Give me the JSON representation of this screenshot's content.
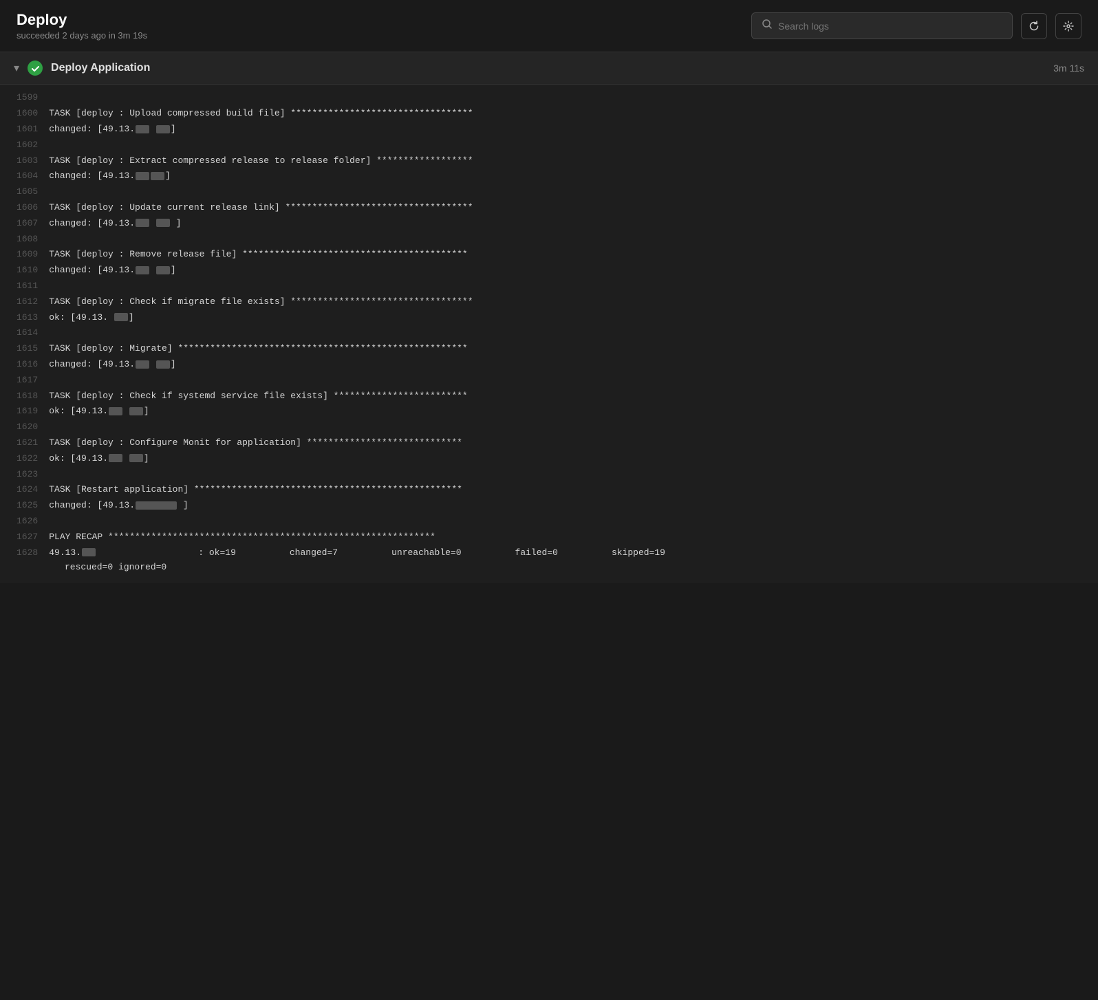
{
  "header": {
    "title": "Deploy",
    "subtitle": "succeeded 2 days ago in 3m 19s",
    "search_placeholder": "Search logs"
  },
  "section": {
    "title": "Deploy Application",
    "duration": "3m 11s",
    "chevron": "▾",
    "status": "✓"
  },
  "toolbar": {
    "refresh_label": "Refresh",
    "settings_label": "Settings"
  },
  "log_lines": [
    {
      "num": "1599",
      "content": ""
    },
    {
      "num": "1600",
      "content": "TASK [deploy : Upload compressed build file] **********************************"
    },
    {
      "num": "1601",
      "content": "changed: [49.13.REDACTED_SM REDACTED]"
    },
    {
      "num": "1602",
      "content": ""
    },
    {
      "num": "1603",
      "content": "TASK [deploy : Extract compressed release to release folder] ******************"
    },
    {
      "num": "1604",
      "content": "changed: [49.13.REDACTED_SM REDACTED_SM]"
    },
    {
      "num": "1605",
      "content": ""
    },
    {
      "num": "1606",
      "content": "TASK [deploy : Update current release link] ***********************************"
    },
    {
      "num": "1607",
      "content": "changed: [49.13.REDACTED_SM REDACTED_SM ]"
    },
    {
      "num": "1608",
      "content": ""
    },
    {
      "num": "1609",
      "content": "TASK [deploy : Remove release file] ******************************************"
    },
    {
      "num": "1610",
      "content": "changed: [49.13.REDACTED_SM REDACTED_SM]"
    },
    {
      "num": "1611",
      "content": ""
    },
    {
      "num": "1612",
      "content": "TASK [deploy : Check if migrate file exists] **********************************"
    },
    {
      "num": "1613",
      "content": "ok: [49.13. REDACTED_SM]"
    },
    {
      "num": "1614",
      "content": ""
    },
    {
      "num": "1615",
      "content": "TASK [deploy : Migrate] ******************************************************"
    },
    {
      "num": "1616",
      "content": "changed: [49.13.REDACTED_SM REDACTED_SM]"
    },
    {
      "num": "1617",
      "content": ""
    },
    {
      "num": "1618",
      "content": "TASK [deploy : Check if systemd service file exists] *************************"
    },
    {
      "num": "1619",
      "content": "ok: [49.13.REDACTED_SM REDACTED_SM]"
    },
    {
      "num": "1620",
      "content": ""
    },
    {
      "num": "1621",
      "content": "TASK [deploy : Configure Monit for application] *****************************"
    },
    {
      "num": "1622",
      "content": "ok: [49.13.REDACTED_SM REDACTED_SM]"
    },
    {
      "num": "1623",
      "content": ""
    },
    {
      "num": "1624",
      "content": "TASK [Restart application] **************************************************"
    },
    {
      "num": "1625",
      "content": "changed: [49.13.REDACTED_SM ]"
    },
    {
      "num": "1626",
      "content": ""
    },
    {
      "num": "1627",
      "content": "PLAY RECAP *************************************************************"
    },
    {
      "num": "1628",
      "content": "RECAP_LINE"
    }
  ],
  "recap": {
    "ip": "49.13.",
    "ok": "ok=19",
    "changed": "changed=7",
    "unreachable": "unreachable=0",
    "failed": "failed=0",
    "skipped": "skipped=19",
    "rescued": "rescued=0",
    "ignored": "ignored=0"
  }
}
